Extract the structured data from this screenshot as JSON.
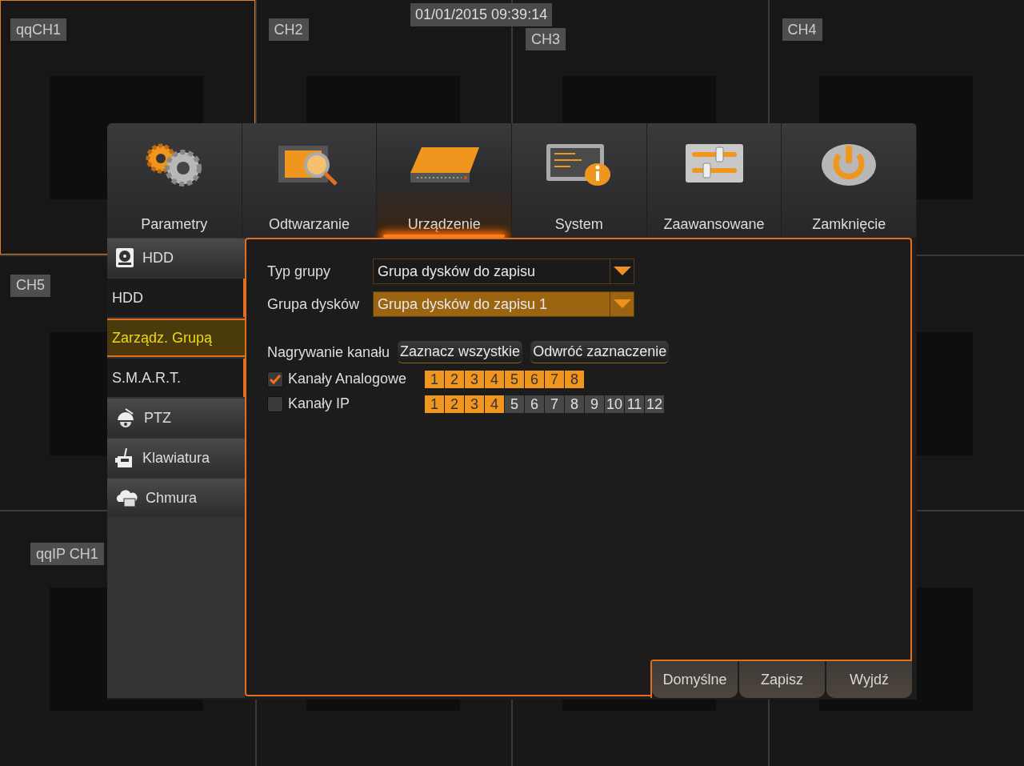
{
  "timestamp": "01/01/2015 09:39:14",
  "video_tiles": [
    {
      "label": "qqCH1",
      "selected": true
    },
    {
      "label": "CH2",
      "selected": false
    },
    {
      "label": "CH3",
      "selected": false
    },
    {
      "label": "CH4",
      "selected": false
    },
    {
      "label": "CH5",
      "selected": false
    },
    {
      "selected": false
    },
    {
      "label": "qqIP CH1",
      "selected": false
    },
    {
      "selected": false
    },
    {
      "selected": false
    },
    {
      "selected": false
    }
  ],
  "menu_tabs": [
    {
      "label": "Parametry",
      "kind": "gears",
      "selected": false
    },
    {
      "label": "Odtwarzanie",
      "kind": "playback",
      "selected": false
    },
    {
      "label": "Urządzenie",
      "kind": "device",
      "selected": true
    },
    {
      "label": "System",
      "kind": "info",
      "selected": false
    },
    {
      "label": "Zaawansowane",
      "kind": "sliders",
      "selected": false
    },
    {
      "label": "Zamknięcie",
      "kind": "power",
      "selected": false
    }
  ],
  "sidebar": [
    {
      "label": "HDD",
      "kind": "hdd",
      "selected": false
    },
    {
      "label": "HDD",
      "kind": "item",
      "selected": false
    },
    {
      "label": "Zarządz. Grupą",
      "kind": "item",
      "selected": true
    },
    {
      "label": "S.M.A.R.T.",
      "kind": "item",
      "selected": false
    },
    {
      "label": "PTZ",
      "kind": "ptz",
      "selected": false
    },
    {
      "label": "Klawiatura",
      "kind": "keyboard",
      "selected": false
    },
    {
      "label": "Chmura",
      "kind": "cloud",
      "selected": false
    }
  ],
  "fields": [
    {
      "label": "Typ grupy",
      "value": "Grupa dysków do zapisu",
      "focused": false
    },
    {
      "label": "Grupa dysków",
      "value": "Grupa dysków do zapisu 1",
      "focused": true
    }
  ],
  "recording": {
    "label": "Nagrywanie kanału",
    "buttons": [
      "Zaznacz wszystkie",
      "Odwróć zaznaczenie"
    ]
  },
  "channel_groups": [
    {
      "label": "Kanały Analogowe",
      "checked": true,
      "channels": [
        {
          "number": "1",
          "selected": true
        },
        {
          "number": "2",
          "selected": true
        },
        {
          "number": "3",
          "selected": true
        },
        {
          "number": "4",
          "selected": true
        },
        {
          "number": "5",
          "selected": true
        },
        {
          "number": "6",
          "selected": true
        },
        {
          "number": "7",
          "selected": true
        },
        {
          "number": "8",
          "selected": true
        }
      ]
    },
    {
      "label": "Kanały IP",
      "checked": false,
      "channels": [
        {
          "number": "1",
          "selected": true
        },
        {
          "number": "2",
          "selected": true
        },
        {
          "number": "3",
          "selected": true
        },
        {
          "number": "4",
          "selected": true
        },
        {
          "number": "5",
          "selected": false
        },
        {
          "number": "6",
          "selected": false
        },
        {
          "number": "7",
          "selected": false
        },
        {
          "number": "8",
          "selected": false
        },
        {
          "number": "9",
          "selected": false
        },
        {
          "number": "10",
          "selected": false
        },
        {
          "number": "11",
          "selected": false
        },
        {
          "number": "12",
          "selected": false
        }
      ]
    }
  ],
  "footer_buttons": [
    "Domyślne",
    "Zapisz",
    "Wyjdź"
  ]
}
